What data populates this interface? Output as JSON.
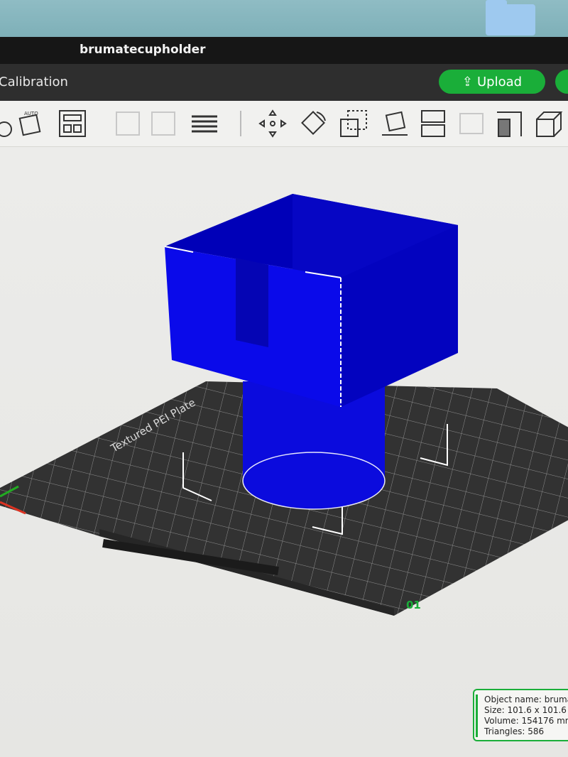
{
  "window": {
    "title": "brumatecupholder"
  },
  "menu": {
    "tab_label": "Calibration",
    "upload_label": "Upload",
    "upload_icon": "upload-icon"
  },
  "toolbar": {
    "tools": [
      "add-icon",
      "auto-orient-icon",
      "arrange-icon",
      "split-objects-icon",
      "split-parts-icon",
      "layers-icon",
      "move-icon",
      "rotate-icon",
      "scale-icon",
      "lay-on-face-icon",
      "cut-icon",
      "support-paint-icon",
      "seam-paint-icon",
      "measure-icon"
    ]
  },
  "viewport": {
    "plate_label": "Textured PEI Plate",
    "plate_number": "01",
    "model_color": "#0a0adf"
  },
  "object_info": {
    "name_line": "Object name: bruma",
    "size_line": "Size: 101.6 x 101.6 x",
    "volume_line": "Volume: 154176 mm",
    "triangles_line": "Triangles: 586"
  },
  "colors": {
    "accent": "#1aae39",
    "titlebar": "#161616",
    "menubar": "#2e2e2e"
  }
}
